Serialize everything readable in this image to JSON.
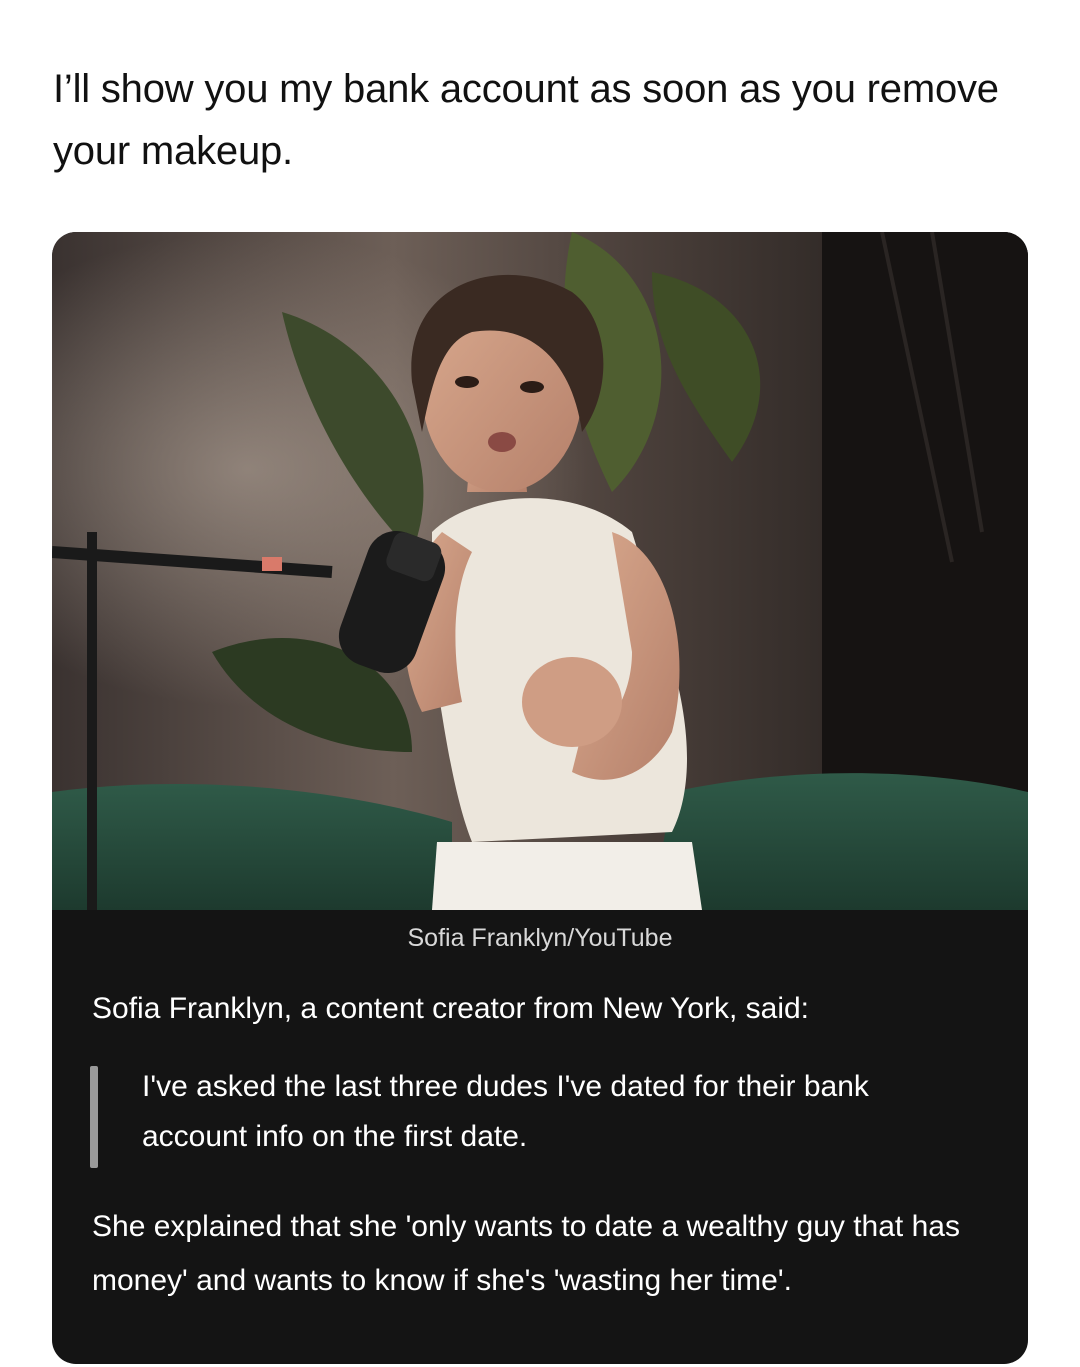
{
  "post": {
    "text": "I’ll show you my bank account as soon as you remove your makeup."
  },
  "article": {
    "photo_caption": "Sofia Franklyn/YouTube",
    "intro": "Sofia Franklyn, a content creator from New York, said:",
    "quote": "I've asked the last three dudes I've dated for their bank account info on the first date.",
    "body": "She explained that she 'only wants to date a wealthy guy that has money' and wants to know if she's 'wasting her time'."
  },
  "colors": {
    "card_background": "#141414",
    "text_on_card": "#ffffff",
    "caption_text": "#d8d8d8",
    "quote_bar": "#9a9a9a",
    "post_text": "#111111"
  }
}
